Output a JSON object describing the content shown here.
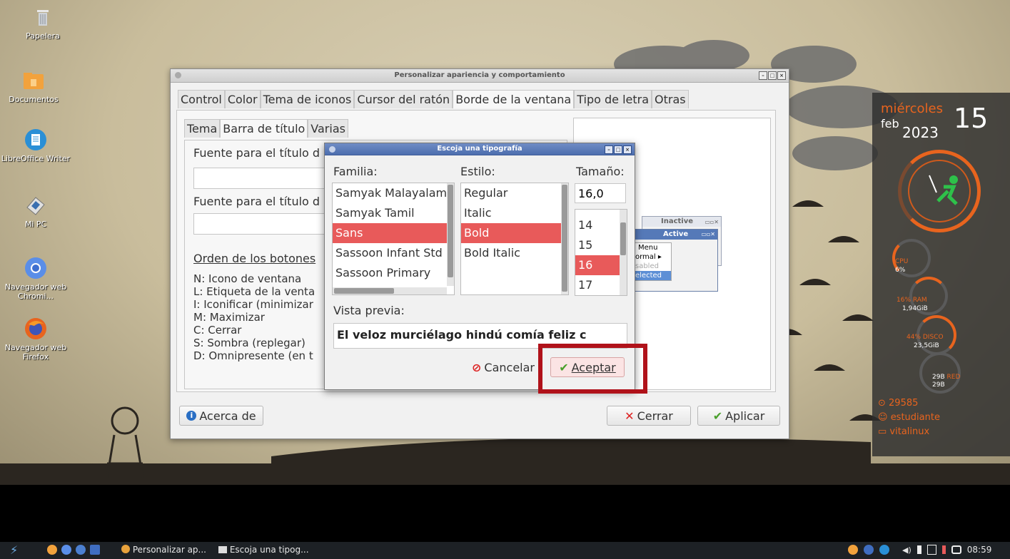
{
  "desktop": {
    "icons": [
      {
        "label": "Papelera",
        "icon": "trash-icon"
      },
      {
        "label": "Documentos",
        "icon": "folder-icon"
      },
      {
        "label": "LibreOffice Writer",
        "icon": "writer-icon"
      },
      {
        "label": "Mi PC",
        "icon": "computer-icon"
      },
      {
        "label": "Navegador web Chromi...",
        "icon": "chromium-icon"
      },
      {
        "label": "Navegador web Firefox",
        "icon": "firefox-icon"
      }
    ]
  },
  "main_window": {
    "title": "Personalizar apariencia y comportamiento",
    "tabs": [
      "Control",
      "Color",
      "Tema de iconos",
      "Cursor del ratón",
      "Borde de la ventana",
      "Tipo de letra",
      "Otras"
    ],
    "active_tab": "Borde de la ventana",
    "subtabs": [
      "Tema",
      "Barra de título",
      "Varias"
    ],
    "active_subtab": "Barra de título",
    "font_active_label": "Fuente para el título d",
    "font_inactive_label": "Fuente para el título d",
    "button_order_label": "Orden de los botones",
    "legend": [
      "N: Icono de ventana",
      "L: Etiqueta de la venta",
      "I: Iconificar (minimizar",
      "M: Maximizar",
      "C: Cerrar",
      "S: Sombra (replegar)",
      "D: Omnipresente (en t"
    ],
    "preview": {
      "inactive_title": "Inactive",
      "active_title": "Active",
      "menu_label": "Menu",
      "items": [
        "ormal",
        "sabled",
        "elected"
      ]
    },
    "about_button": "Acerca de",
    "close_button": "Cerrar",
    "apply_button": "Aplicar"
  },
  "font_dialog": {
    "title": "Escoja una tipografía",
    "family_label": "Familia:",
    "style_label": "Estilo:",
    "size_label": "Tamaño:",
    "families": [
      "Samyak Malayalam",
      "Samyak Tamil",
      "Sans",
      "Sassoon Infant Std",
      "Sassoon Primary"
    ],
    "selected_family": "Sans",
    "styles": [
      "Regular",
      "Italic",
      "Bold",
      "Bold Italic"
    ],
    "selected_style": "Bold",
    "size_value": "16,0",
    "sizes": [
      "14",
      "15",
      "16",
      "17"
    ],
    "selected_size": "16",
    "preview_label": "Vista previa:",
    "preview_text": "El veloz murciélago hindú comía feliz c",
    "cancel_button": "Cancelar",
    "ok_button": "Aceptar"
  },
  "conky": {
    "weekday": "miércoles",
    "month": "feb",
    "year": "2023",
    "day": "15",
    "cpu_label": "CPU",
    "cpu_value": "6%",
    "ram_label": "16% RAM",
    "ram_value": "1,94GiB",
    "disk_label": "44% DISCO",
    "disk_value": "23,5GiB",
    "net_up": "29B",
    "net_label": "RED",
    "net_down": "29B",
    "uptime": "29585",
    "user": "estudiante",
    "host": "vitalinux",
    "accent": "#e8641e"
  },
  "taskbar": {
    "tasks": [
      "Personalizar ap...",
      "Escoja una tipog..."
    ],
    "clock": "08:59"
  }
}
